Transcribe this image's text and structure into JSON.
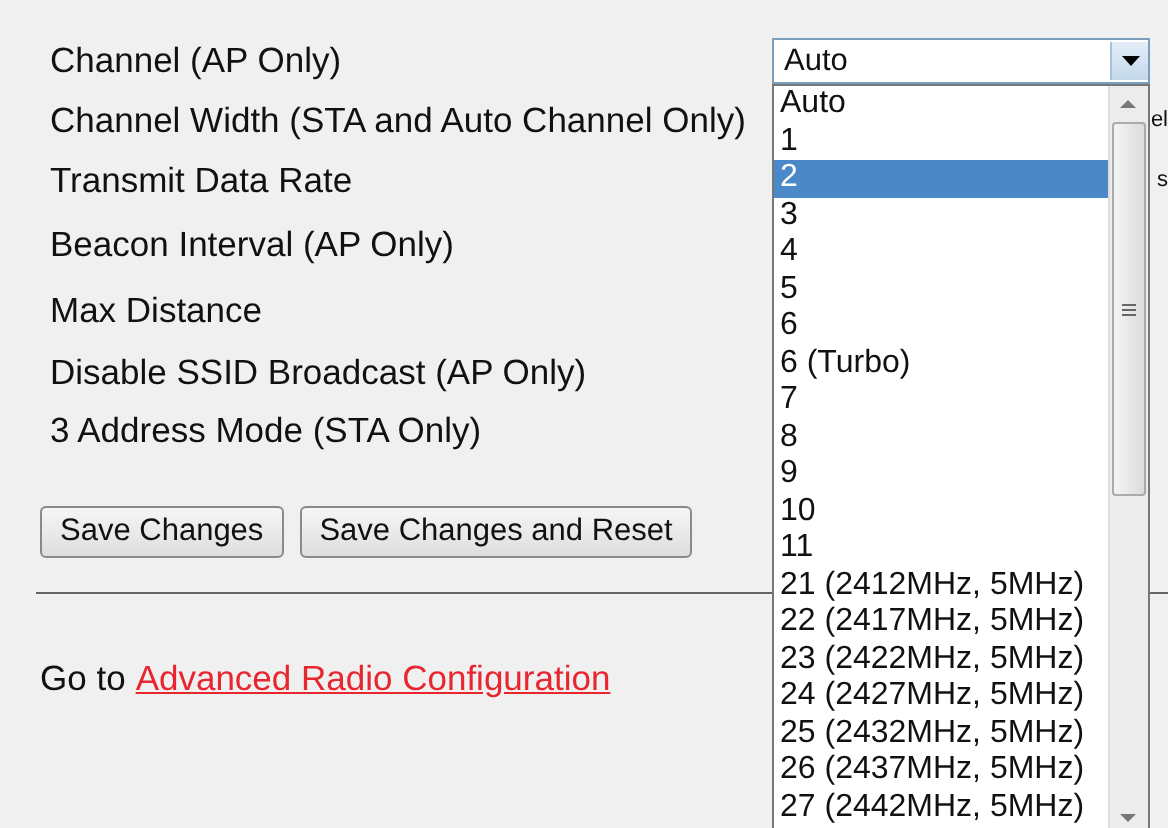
{
  "fields": [
    {
      "label": "Channel (AP Only)"
    },
    {
      "label": "Channel Width (STA and Auto Channel Only)",
      "column_2": "el"
    },
    {
      "label": "Transmit Data Rate",
      "column_2": "s"
    },
    {
      "label": "Beacon Interval (AP Only)"
    },
    {
      "label": "Max Distance"
    },
    {
      "label": "Disable SSID Broadcast (AP Only)"
    },
    {
      "label": "3 Address Mode (STA Only)"
    }
  ],
  "buttons": [
    "Save Changes",
    "Save Changes and Reset"
  ],
  "footer": {
    "prefix": "Go to",
    "link": "Advanced Radio Configuration"
  },
  "channel_select": {
    "value": "Auto",
    "expanded": true,
    "options": [
      {
        "label": "Auto",
        "highlighted": false
      },
      {
        "label": "1",
        "highlighted": false
      },
      {
        "label": "2",
        "highlighted": true
      },
      {
        "label": "3",
        "highlighted": false
      },
      {
        "label": "4",
        "highlighted": false
      },
      {
        "label": "5",
        "highlighted": false
      },
      {
        "label": "6",
        "highlighted": false
      },
      {
        "label": "6 (Turbo)",
        "highlighted": false
      },
      {
        "label": "7",
        "highlighted": false
      },
      {
        "label": "8",
        "highlighted": false
      },
      {
        "label": "9",
        "highlighted": false
      },
      {
        "label": "10",
        "highlighted": false
      },
      {
        "label": "11",
        "highlighted": false
      },
      {
        "label": "21 (2412MHz, 5MHz)",
        "highlighted": false
      },
      {
        "label": "22 (2417MHz, 5MHz)",
        "highlighted": false
      },
      {
        "label": "23 (2422MHz, 5MHz)",
        "highlighted": false
      },
      {
        "label": "24 (2427MHz, 5MHz)",
        "highlighted": false
      },
      {
        "label": "25 (2432MHz, 5MHz)",
        "highlighted": false
      },
      {
        "label": "26 (2437MHz, 5MHz)",
        "highlighted": false
      },
      {
        "label": "27 (2442MHz, 5MHz)",
        "highlighted": false
      }
    ]
  }
}
